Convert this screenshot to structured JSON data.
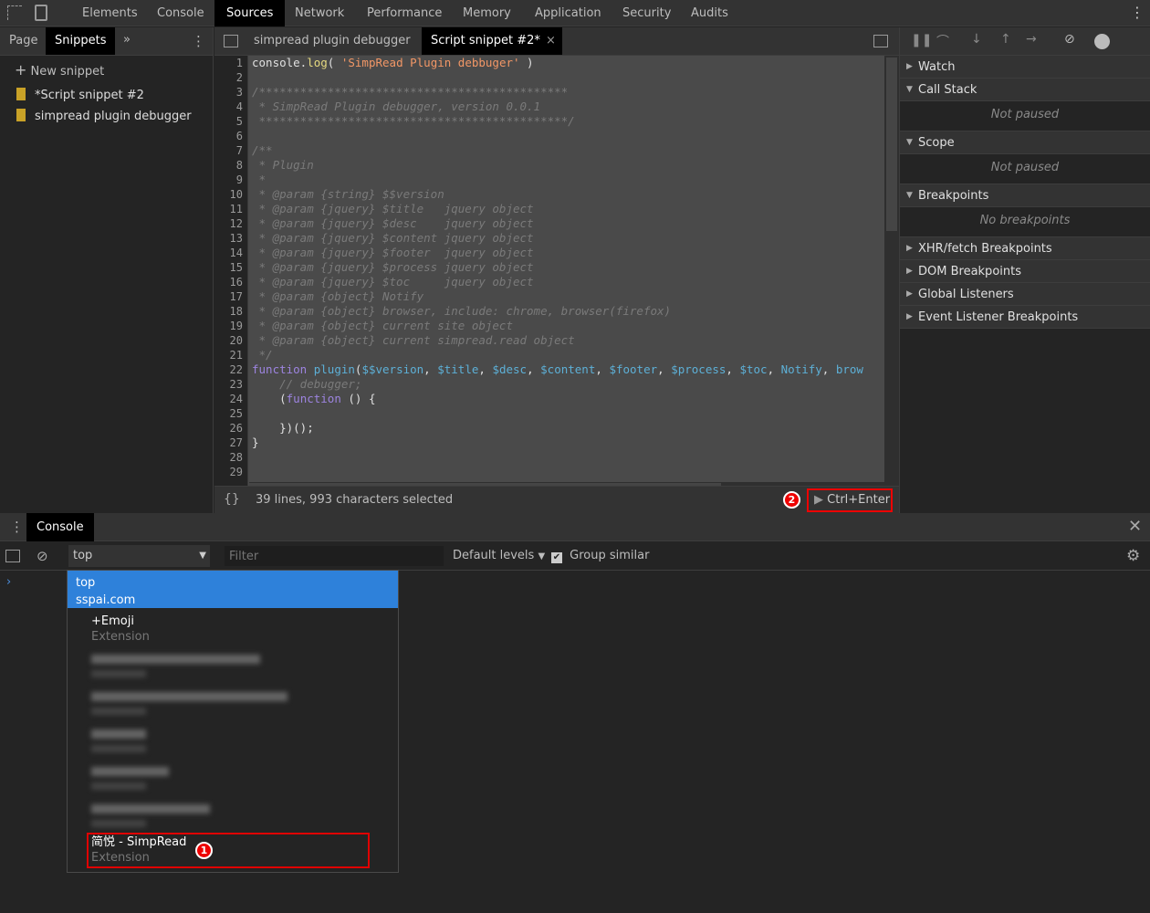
{
  "topbar": {
    "tabs": [
      "Elements",
      "Console",
      "Sources",
      "Network",
      "Performance",
      "Memory",
      "Application",
      "Security",
      "Audits"
    ],
    "active": "Sources"
  },
  "navigator": {
    "tabs": [
      "Page",
      "Snippets"
    ],
    "active": "Snippets",
    "new_snippet": "New snippet",
    "files": [
      "*Script snippet #2",
      "simpread plugin debugger"
    ]
  },
  "editor": {
    "tabs": [
      "simpread plugin debugger",
      "Script snippet #2*"
    ],
    "active": "Script snippet #2*",
    "lines": [
      [
        [
          "tx",
          "console."
        ],
        [
          "me",
          "log"
        ],
        [
          "tx",
          "( "
        ],
        [
          "st",
          "'SimpRead Plugin debbuger'"
        ],
        [
          "tx",
          " )"
        ]
      ],
      [],
      [
        [
          "cm",
          "/*********************************************"
        ]
      ],
      [
        [
          "cm",
          " * SimpRead Plugin debugger, version 0.0.1"
        ]
      ],
      [
        [
          "cm",
          " *********************************************/"
        ]
      ],
      [],
      [
        [
          "cm",
          "/**"
        ]
      ],
      [
        [
          "cm",
          " * Plugin"
        ]
      ],
      [
        [
          "cm",
          " *"
        ]
      ],
      [
        [
          "cm",
          " * @param {string} $$version"
        ]
      ],
      [
        [
          "cm",
          " * @param {jquery} $title   jquery object"
        ]
      ],
      [
        [
          "cm",
          " * @param {jquery} $desc    jquery object"
        ]
      ],
      [
        [
          "cm",
          " * @param {jquery} $content jquery object"
        ]
      ],
      [
        [
          "cm",
          " * @param {jquery} $footer  jquery object"
        ]
      ],
      [
        [
          "cm",
          " * @param {jquery} $process jquery object"
        ]
      ],
      [
        [
          "cm",
          " * @param {jquery} $toc     jquery object"
        ]
      ],
      [
        [
          "cm",
          " * @param {object} Notify"
        ]
      ],
      [
        [
          "cm",
          " * @param {object} browser, include: chrome, browser(firefox)"
        ]
      ],
      [
        [
          "cm",
          " * @param {object} current site object"
        ]
      ],
      [
        [
          "cm",
          " * @param {object} current simpread.read object"
        ]
      ],
      [
        [
          "cm",
          " */"
        ]
      ],
      [
        [
          "kw",
          "function"
        ],
        [
          "tx",
          " "
        ],
        [
          "fn",
          "plugin"
        ],
        [
          "tx",
          "("
        ],
        [
          "pr",
          "$$version"
        ],
        [
          "tx",
          ", "
        ],
        [
          "pr",
          "$title"
        ],
        [
          "tx",
          ", "
        ],
        [
          "pr",
          "$desc"
        ],
        [
          "tx",
          ", "
        ],
        [
          "pr",
          "$content"
        ],
        [
          "tx",
          ", "
        ],
        [
          "pr",
          "$footer"
        ],
        [
          "tx",
          ", "
        ],
        [
          "pr",
          "$process"
        ],
        [
          "tx",
          ", "
        ],
        [
          "pr",
          "$toc"
        ],
        [
          "tx",
          ", "
        ],
        [
          "pr",
          "Notify"
        ],
        [
          "tx",
          ", "
        ],
        [
          "pr",
          "brow"
        ]
      ],
      [
        [
          "tx",
          "    "
        ],
        [
          "cm",
          "// debugger;"
        ]
      ],
      [
        [
          "tx",
          "    ("
        ],
        [
          "kw",
          "function"
        ],
        [
          "tx",
          " () {"
        ]
      ],
      [],
      [
        [
          "tx",
          "    })();"
        ]
      ],
      [
        [
          "tx",
          "}"
        ]
      ],
      [],
      []
    ],
    "status": "39 lines, 993 characters selected",
    "format_icon": "{}",
    "run_label": "Ctrl+Enter",
    "run_badge": "2"
  },
  "debugger": {
    "sections": [
      {
        "title": "Watch",
        "open": false
      },
      {
        "title": "Call Stack",
        "open": true,
        "empty": "Not paused"
      },
      {
        "title": "Scope",
        "open": true,
        "empty": "Not paused"
      },
      {
        "title": "Breakpoints",
        "open": true,
        "empty": "No breakpoints"
      },
      {
        "title": "XHR/fetch Breakpoints",
        "open": false
      },
      {
        "title": "DOM Breakpoints",
        "open": false
      },
      {
        "title": "Global Listeners",
        "open": false
      },
      {
        "title": "Event Listener Breakpoints",
        "open": false
      }
    ]
  },
  "console": {
    "tab": "Console",
    "context": "top",
    "filter_placeholder": "Filter",
    "levels": "Default levels",
    "group_similar": "Group similar",
    "group_similar_checked": true,
    "dropdown": {
      "selected": {
        "name": "top",
        "sub": "sspai.com"
      },
      "items": [
        {
          "name": "+Emoji",
          "sub": "Extension"
        },
        {
          "blurred": true
        },
        {
          "blurred": true
        },
        {
          "blurred": true
        },
        {
          "blurred": true
        },
        {
          "blurred": true
        },
        {
          "name": "简悦 - SimpRead",
          "sub": "Extension",
          "highlighted": true,
          "badge": "1"
        }
      ]
    }
  },
  "colors": {
    "accent": "#2e81da",
    "highlight_box": "#e00000"
  }
}
